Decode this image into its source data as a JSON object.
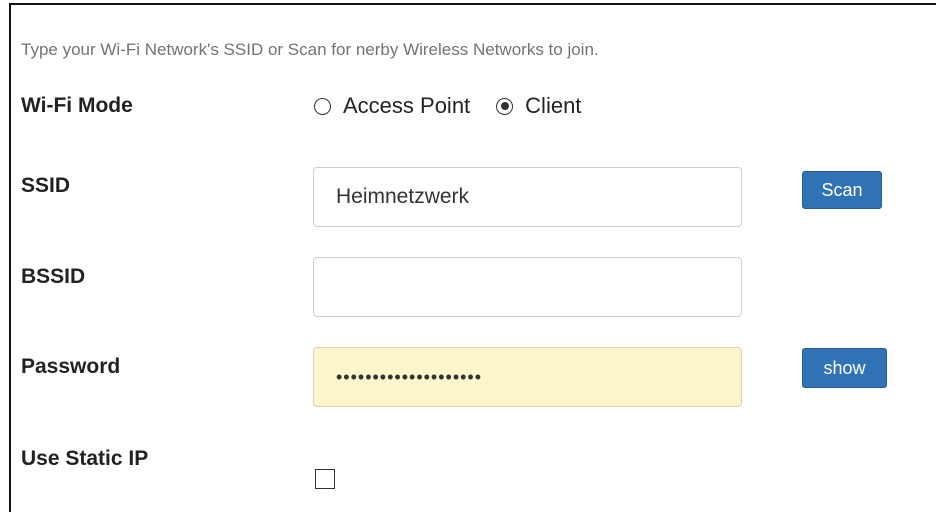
{
  "help_text": "Type your Wi-Fi Network's SSID or Scan for nerby Wireless Networks to join.",
  "wifi_mode": {
    "label": "Wi-Fi Mode",
    "options": [
      {
        "label": "Access Point",
        "selected": false
      },
      {
        "label": "Client",
        "selected": true
      }
    ]
  },
  "ssid": {
    "label": "SSID",
    "value": "Heimnetzwerk",
    "scan_button": "Scan"
  },
  "bssid": {
    "label": "BSSID",
    "value": ""
  },
  "password": {
    "label": "Password",
    "masked_value": "••••••••••••••••••••",
    "show_button": "show"
  },
  "static_ip": {
    "label": "Use Static IP",
    "checked": false
  },
  "colors": {
    "button_primary": "#2f72b6",
    "autofill_background": "#fdf6cc",
    "help_text": "#737373"
  }
}
